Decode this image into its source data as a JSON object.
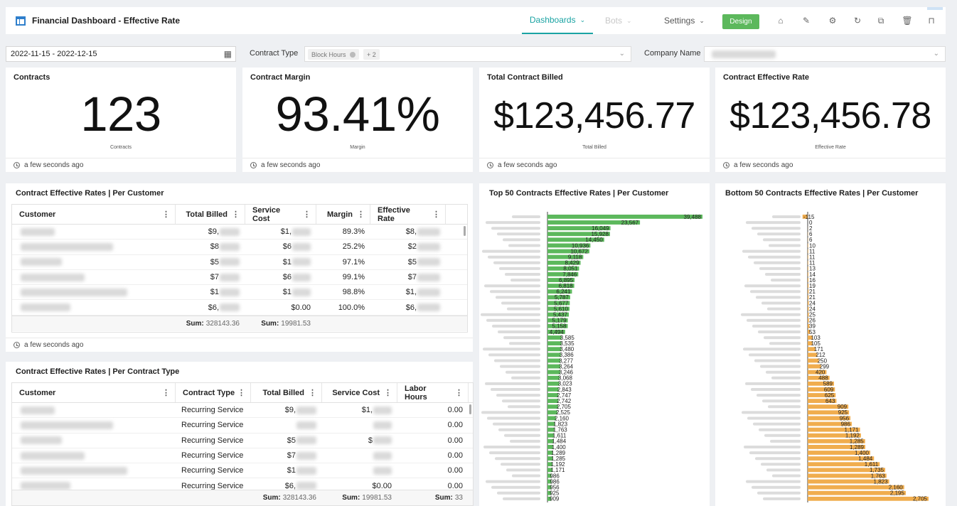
{
  "header": {
    "title": "Financial Dashboard - Effective Rate",
    "nav": [
      {
        "label": "Dashboards",
        "state": "active"
      },
      {
        "label": "Bots",
        "state": "disabled"
      },
      {
        "label": "Settings",
        "state": "normal"
      }
    ],
    "design_label": "Design",
    "tool_icons": [
      "add-dashboard-icon",
      "edit-icon",
      "gear-icon",
      "refresh-icon",
      "copy-icon",
      "trash-icon",
      "pin-icon"
    ]
  },
  "filters": {
    "date_range": "2022-11-15 - 2022-12-15",
    "contract_type_label": "Contract Type",
    "contract_type_chip": "Block Hours",
    "contract_type_more": "+ 2",
    "company_name_label": "Company Name"
  },
  "kpis": [
    {
      "title": "Contracts",
      "value": "123",
      "sub": "Contracts",
      "updated": "a few seconds ago"
    },
    {
      "title": "Contract Margin",
      "value": "93.41%",
      "sub": "Margin",
      "updated": "a few seconds ago"
    },
    {
      "title": "Total Contract Billed",
      "value": "$123,456.77",
      "sub": "Total Billed",
      "updated": "a few seconds ago"
    },
    {
      "title": "Contract Effective Rate",
      "value": "$123,456.78",
      "sub": "Effective Rate",
      "updated": "a few seconds ago"
    }
  ],
  "table_customer": {
    "title": "Contract Effective Rates | Per Customer",
    "columns": [
      "Customer",
      "Total Billed",
      "Service Cost",
      "Margin",
      "Effective Rate"
    ],
    "rows": [
      {
        "billed": "$9,",
        "cost": "$1,",
        "margin": "89.3%",
        "rate": "$8,"
      },
      {
        "billed": "$8",
        "cost": "$6",
        "margin": "25.2%",
        "rate": "$2"
      },
      {
        "billed": "$5",
        "cost": "$1",
        "margin": "97.1%",
        "rate": "$5"
      },
      {
        "billed": "$7",
        "cost": "$6",
        "margin": "99.1%",
        "rate": "$7"
      },
      {
        "billed": "$1",
        "cost": "$1",
        "margin": "98.8%",
        "rate": "$1,"
      },
      {
        "billed": "$6,",
        "cost": "$0.00",
        "margin": "100.0%",
        "rate": "$6,"
      }
    ],
    "sum_billed": "328143.36",
    "sum_cost": "19981.53",
    "sum_label": "Sum:",
    "updated": "a few seconds ago"
  },
  "table_type": {
    "title": "Contract Effective Rates | Per Contract Type",
    "columns": [
      "Customer",
      "Contract Type",
      "Total Billed",
      "Service Cost",
      "Labor Hours"
    ],
    "rows": [
      {
        "type": "Recurring Service",
        "billed": "$9,",
        "cost": "$1,",
        "hours": "0.00"
      },
      {
        "type": "Recurring Service",
        "billed": "",
        "cost": "",
        "hours": "0.00"
      },
      {
        "type": "Recurring Service",
        "billed": "$5",
        "cost": "$",
        "hours": "0.00"
      },
      {
        "type": "Recurring Service",
        "billed": "$7",
        "cost": "",
        "hours": "0.00"
      },
      {
        "type": "Recurring Service",
        "billed": "$1",
        "cost": "",
        "hours": "0.00"
      },
      {
        "type": "Recurring Service",
        "billed": "$6,",
        "cost": "$0.00",
        "hours": "0.00"
      }
    ],
    "sum_billed": "328143.36",
    "sum_cost": "19981.53",
    "sum_hours": "33",
    "sum_label": "Sum:"
  },
  "chart_data": [
    {
      "type": "bar",
      "orientation": "horizontal",
      "title": "Top 50 Contracts Effective Rates | Per Customer",
      "color": "#5cb85c",
      "values": [
        39488,
        23567,
        16049,
        15928,
        14450,
        10936,
        10672,
        9118,
        8429,
        8051,
        7846,
        6895,
        6818,
        6241,
        5787,
        5677,
        5610,
        5437,
        5179,
        5158,
        4494,
        3585,
        3535,
        3480,
        3386,
        3277,
        3264,
        3246,
        3068,
        3023,
        2843,
        2747,
        2742,
        2705,
        2525,
        2160,
        1823,
        1763,
        1611,
        1484,
        1400,
        1289,
        1285,
        1192,
        1171,
        986,
        986,
        956,
        925,
        909
      ]
    },
    {
      "type": "bar",
      "orientation": "horizontal",
      "title": "Bottom 50 Contracts Effective Rates | Per Customer",
      "color": "#f0ad4e",
      "values": [
        -115,
        0,
        2,
        6,
        6,
        10,
        11,
        11,
        11,
        13,
        14,
        16,
        19,
        21,
        21,
        24,
        24,
        25,
        26,
        39,
        53,
        103,
        105,
        171,
        212,
        250,
        299,
        420,
        488,
        589,
        609,
        625,
        643,
        909,
        925,
        956,
        986,
        1171,
        1192,
        1285,
        1289,
        1400,
        1484,
        1611,
        1735,
        1763,
        1823,
        2160,
        2195,
        2705
      ]
    }
  ]
}
